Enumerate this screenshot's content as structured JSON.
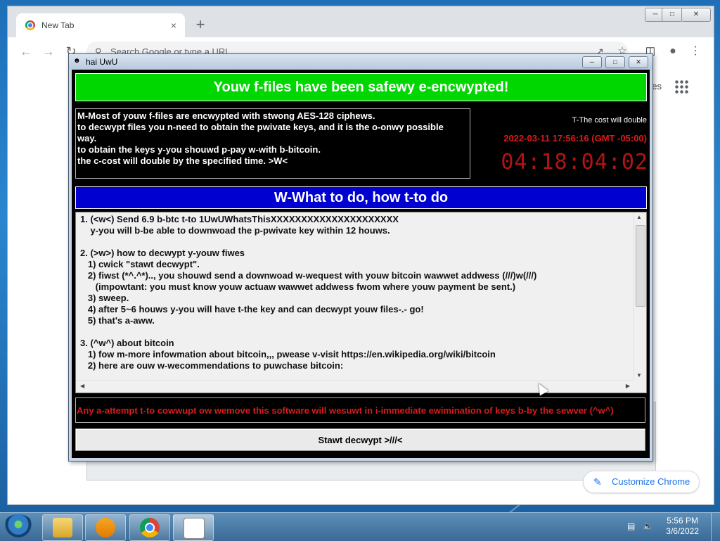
{
  "browser": {
    "tab_title": "New Tab",
    "tab_close": "×",
    "new_tab": "+",
    "omnibox_placeholder": "Search Google or type a URL",
    "partial_link_text": "es",
    "customize_label": "Customize Chrome"
  },
  "ransom_window": {
    "title": "hai UwU",
    "header": "Youw f-files have been safewy e-encwypted!",
    "message_lines": [
      "M-Most of youw f-files are encwypted with stwong AES-128 ciphews.",
      "to decwypt files you n-need to obtain the pwivate keys, and it is the o-onwy possible",
      "way.",
      "to obtain the keys y-you shouwd p-pay w-with b-bitcoin.",
      "the c-cost will double by the specified time. >W<"
    ],
    "cost_note": "T-The cost will double",
    "deadline": "2022-03-11 17:56:16 (GMT -05:00)",
    "countdown": "04:18:04:02",
    "what_to_do_header": "W-What to do, how t-to do",
    "instructions": [
      "1. (<w<) Send 6.9 b-btc t-to 1UwUWhatsThisXXXXXXXXXXXXXXXXXXXXX",
      "    y-you will b-be able to downwoad the p-pwivate key within 12 houws.",
      "",
      "2. (>w>) how to decwypt y-youw fiwes",
      "   1) cwick \"stawt decwypt\".",
      "   2) fiwst (*^.^*).., you shouwd send a downwoad w-wequest with youw bitcoin wawwet addwess (///)w(///)",
      "      (impowtant: you must know youw actuaw wawwet addwess fwom where youw payment be sent.)",
      "   3) sweep.",
      "   4) after 5~6 houws y-you will have t-the key and can decwypt youw files-.- go!",
      "   5) that's a-aww.",
      "",
      "3. (^w^) about bitcoin",
      "   1) fow m-more infowmation about bitcoin,,, pwease v-visit https://en.wikipedia.org/wiki/bitcoin",
      "   2) here are ouw w-wecommendations to puwchase bitcoin:"
    ],
    "warning": "Any a-attempt t-to cowwupt ow wemove this software will wesuwt in i-immediate ewimination of keys b-by the sewver (^w^)",
    "decrypt_button": "Stawt decwypt >///<"
  },
  "taskbar": {
    "time": "5:56 PM",
    "date": "3/6/2022"
  },
  "colors": {
    "banner_green": "#00d700",
    "banner_blue": "#0000d0",
    "alert_red": "#d81b1b"
  },
  "icons": [
    "chrome-favicon",
    "search-icon",
    "apps-grid-icon",
    "pencil-icon",
    "windows-start-icon",
    "explorer-icon",
    "media-player-icon",
    "chrome-icon",
    "ransomware-app-icon",
    "network-icon",
    "volume-icon"
  ]
}
